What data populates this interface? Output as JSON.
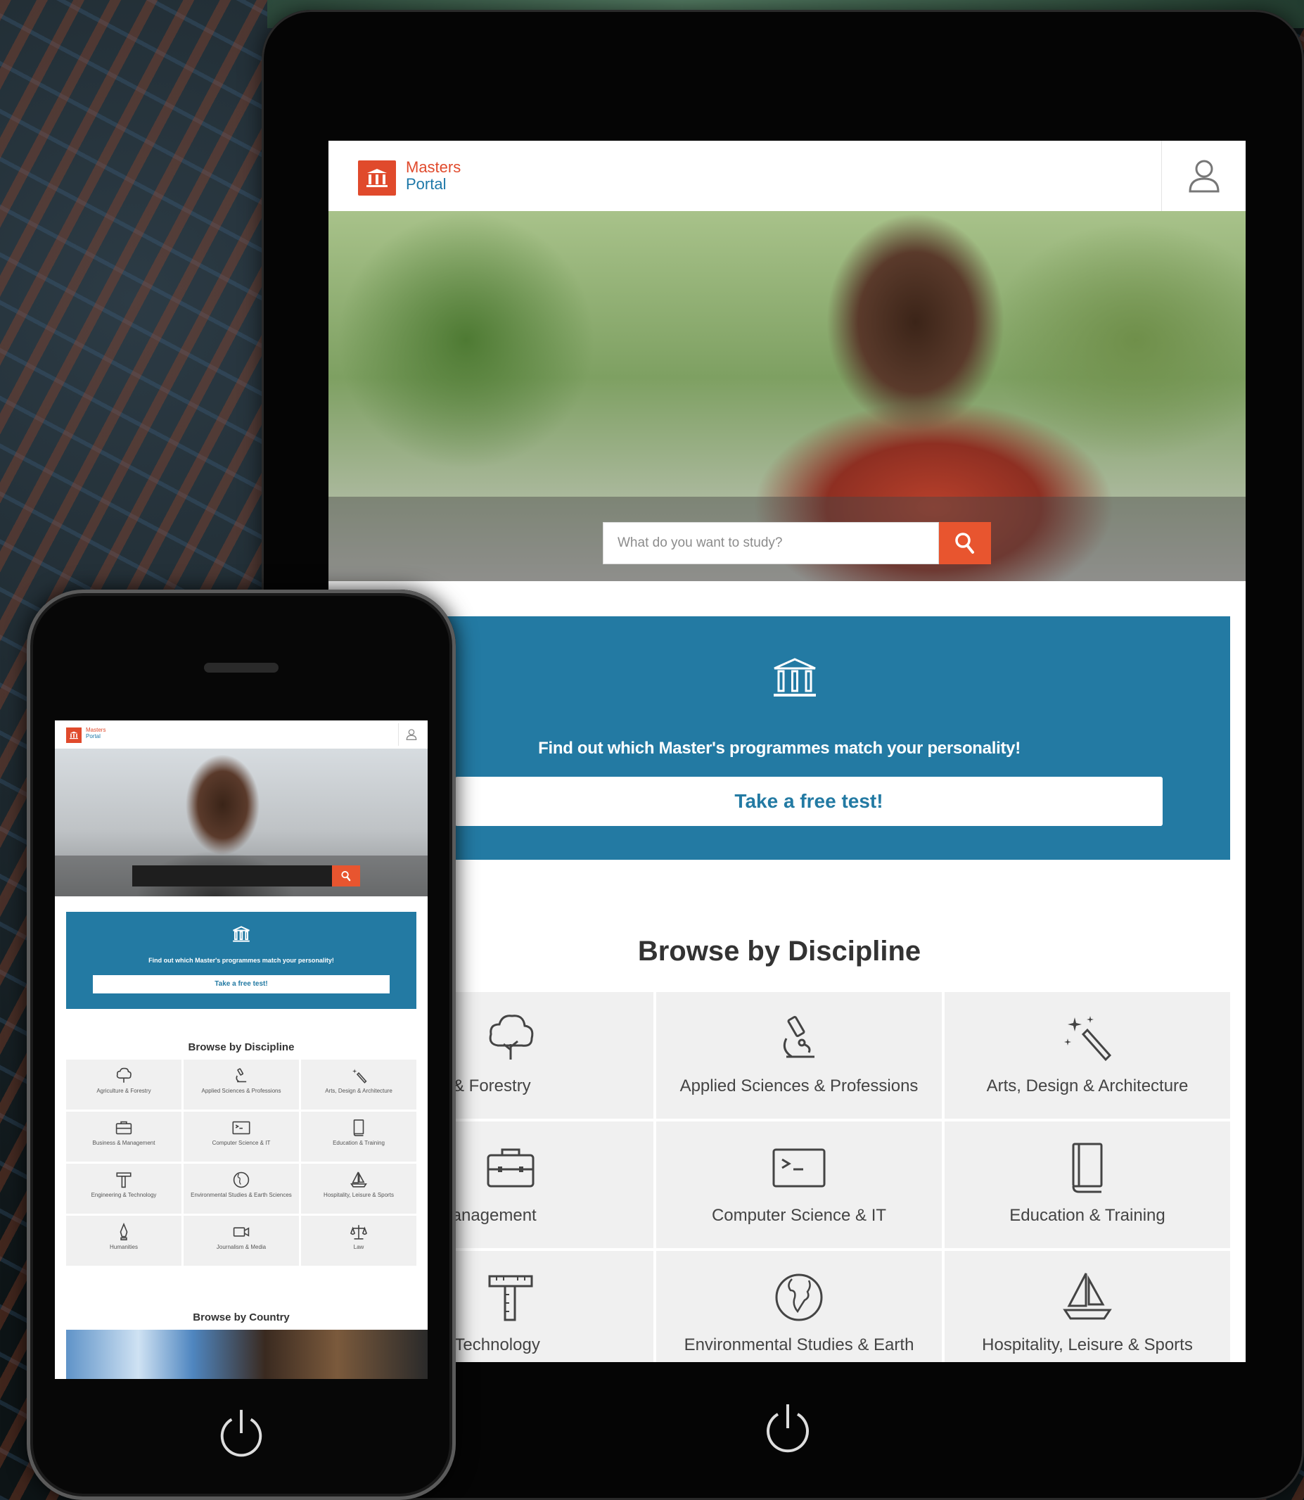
{
  "tablet": {
    "logo": {
      "line1": "Masters",
      "line2": "Portal"
    },
    "search": {
      "placeholder": "What do you want to study?"
    },
    "promo": {
      "text": "Find out which Master's programmes match your personality!",
      "button_label": "Take a free test!"
    },
    "browse_title": "Browse by Discipline",
    "disciplines": [
      {
        "label": "ulture & Forestry",
        "icon": "tree-icon"
      },
      {
        "label": "Applied Sciences & Professions",
        "icon": "microscope-icon"
      },
      {
        "label": "Arts, Design & Architecture",
        "icon": "magic-wand-icon"
      },
      {
        "label": "ss & Management",
        "icon": "briefcase-icon"
      },
      {
        "label": "Computer Science & IT",
        "icon": "terminal-icon"
      },
      {
        "label": "Education & Training",
        "icon": "book-icon"
      },
      {
        "label": "ering & Technology",
        "icon": "ruler-t-icon"
      },
      {
        "label": "Environmental Studies & Earth",
        "icon": "globe-icon"
      },
      {
        "label": "Hospitality, Leisure & Sports",
        "icon": "sailboat-icon"
      }
    ]
  },
  "phone": {
    "logo": {
      "line1": "Masters",
      "line2": "Portal"
    },
    "promo": {
      "text": "Find out which Master's programmes match your personality!",
      "button_label": "Take a free test!"
    },
    "browse_title": "Browse by Discipline",
    "disciplines": [
      {
        "label": "Agriculture & Forestry",
        "icon": "tree-icon"
      },
      {
        "label": "Applied Sciences & Professions",
        "icon": "microscope-icon"
      },
      {
        "label": "Arts, Design & Architecture",
        "icon": "magic-wand-icon"
      },
      {
        "label": "Business & Management",
        "icon": "briefcase-icon"
      },
      {
        "label": "Computer Science & IT",
        "icon": "terminal-icon"
      },
      {
        "label": "Education & Training",
        "icon": "book-icon"
      },
      {
        "label": "Engineering & Technology",
        "icon": "ruler-t-icon"
      },
      {
        "label": "Environmental Studies & Earth Sciences",
        "icon": "globe-icon"
      },
      {
        "label": "Hospitality, Leisure & Sports",
        "icon": "sailboat-icon"
      },
      {
        "label": "Humanities",
        "icon": "pen-icon"
      },
      {
        "label": "Journalism & Media",
        "icon": "video-camera-icon"
      },
      {
        "label": "Law",
        "icon": "scales-icon"
      }
    ],
    "country_title": "Browse by Country"
  },
  "colors": {
    "brand_red": "#e04a2c",
    "brand_blue": "#237aa3",
    "search_orange": "#e8552f"
  }
}
